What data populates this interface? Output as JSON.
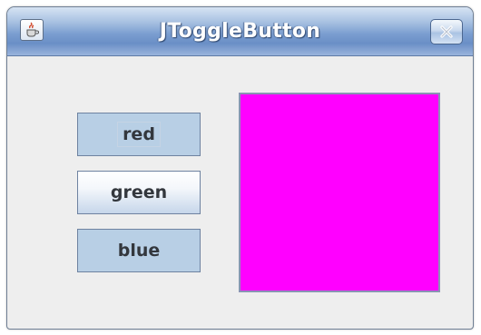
{
  "window": {
    "title": "JToggleButton"
  },
  "titlebar": {
    "app_icon": "java-cup-icon",
    "close_icon": "close-icon"
  },
  "buttons": [
    {
      "label": "red",
      "selected": true
    },
    {
      "label": "green",
      "selected": false
    },
    {
      "label": "blue",
      "selected": true
    }
  ],
  "colors": {
    "panel": "#ff00ff",
    "toggle_selected": "#b8cfe5"
  }
}
